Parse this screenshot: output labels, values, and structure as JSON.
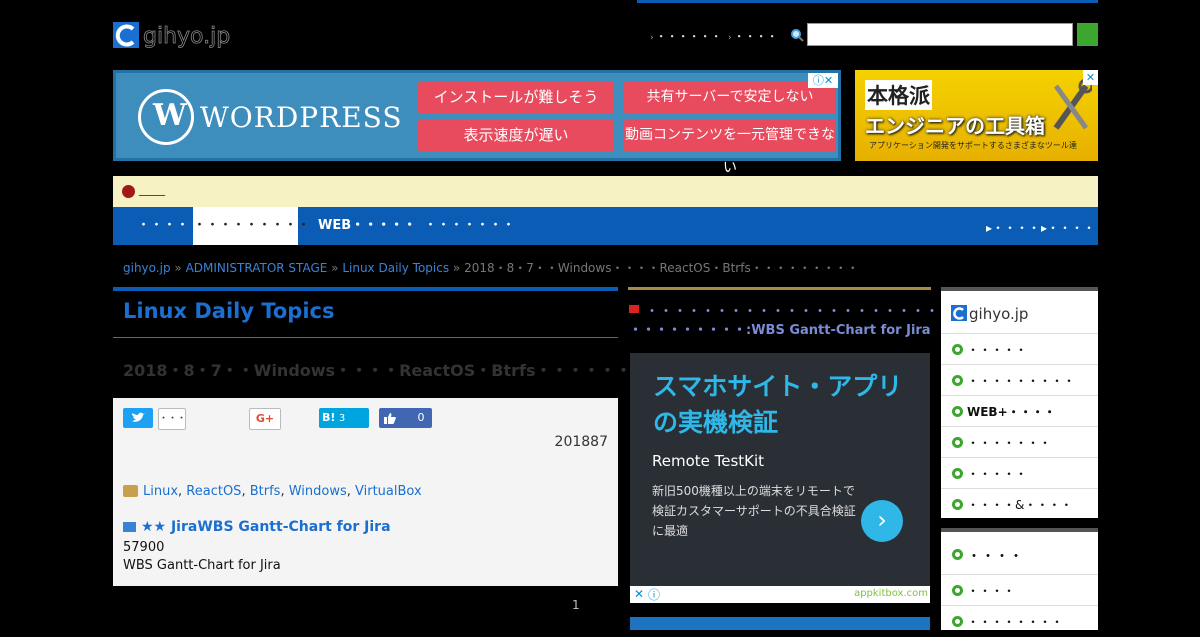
{
  "header": {
    "logo_text": "gihyo.jp",
    "links": [
      "・・・・・・",
      "・・・・"
    ],
    "search_placeholder": ""
  },
  "wordpress_ad": {
    "brand": "WORDPRESS",
    "buttons": [
      "インストールが難しそう",
      "共有サーバーで安定しない",
      "表示速度が遅い",
      "動画コンテンツを一元管理できない"
    ],
    "close_label": "ⓘ✕"
  },
  "tool_ad": {
    "line1": "本格派",
    "line2": "エンジニアの工具箱",
    "line3": "アプリケーション開発をサポートするさまざまなツール達"
  },
  "notice": {
    "text": "____"
  },
  "nav": {
    "items": [
      "・・・・・",
      "・・・・・・・・・",
      "WEB・・・・・",
      "・・・・・・・"
    ],
    "active_index": 1,
    "sub_links": [
      "・・・・",
      "・・・・"
    ]
  },
  "breadcrumb": {
    "home": "gihyo.jp",
    "sep": "»",
    "section": "ADMINISTRATOR STAGE",
    "category": "Linux Daily Topics",
    "current": "2018・8・7・・Windows・・・・ReactOS・Btrfs・・・・・・・・・"
  },
  "article": {
    "category_title": "Linux Daily Topics",
    "title": "2018・8・7・・Windows・・・・ReactOS・Btrfs・・・・・・・・・",
    "social": {
      "tweet_count": "・・・",
      "hatena_label": "B!",
      "hatena_count": "3",
      "like_count": "0"
    },
    "date": "201887",
    "tags": [
      "Linux",
      "ReactOS",
      "Btrfs",
      "Windows",
      "VirtualBox"
    ],
    "related_link": "★★ JiraWBS Gantt-Chart for Jira",
    "related_line1": "57900",
    "related_line2": "WBS Gantt-Chart for Jira"
  },
  "pagination": {
    "page": "1"
  },
  "promo": {
    "line1": "・・・・・・・・・・・・・・・・・・・・・",
    "line2": "・・・・・・・・・:WBS Gantt-Chart for Jira"
  },
  "kit_ad": {
    "title": "スマホサイト・アプリの実機検証",
    "name": "Remote TestKit",
    "desc": "新旧500機種以上の端末をリモートで検証カスタマーサポートの不具合検証に最適",
    "domain": "appkitbox.com",
    "close": "✕",
    "info": "ⓘ",
    "arrow": "›"
  },
  "sidebar": {
    "logo_text": "gihyo.jp",
    "items": [
      "・・・・・",
      "・・・・・・・・・",
      "WEB+・・・・",
      "・・・・・・・",
      "・・・・・",
      "・・・・&・・・・"
    ],
    "box2_title": "・・・・",
    "box2_items": [
      "・・・・",
      "・・・・・・・・"
    ]
  },
  "colors": {
    "brand_blue": "#0a5cb5",
    "link_blue": "#1a6fd1",
    "accent_green": "#3ca62f",
    "notice_bg": "#f7f2c4"
  }
}
